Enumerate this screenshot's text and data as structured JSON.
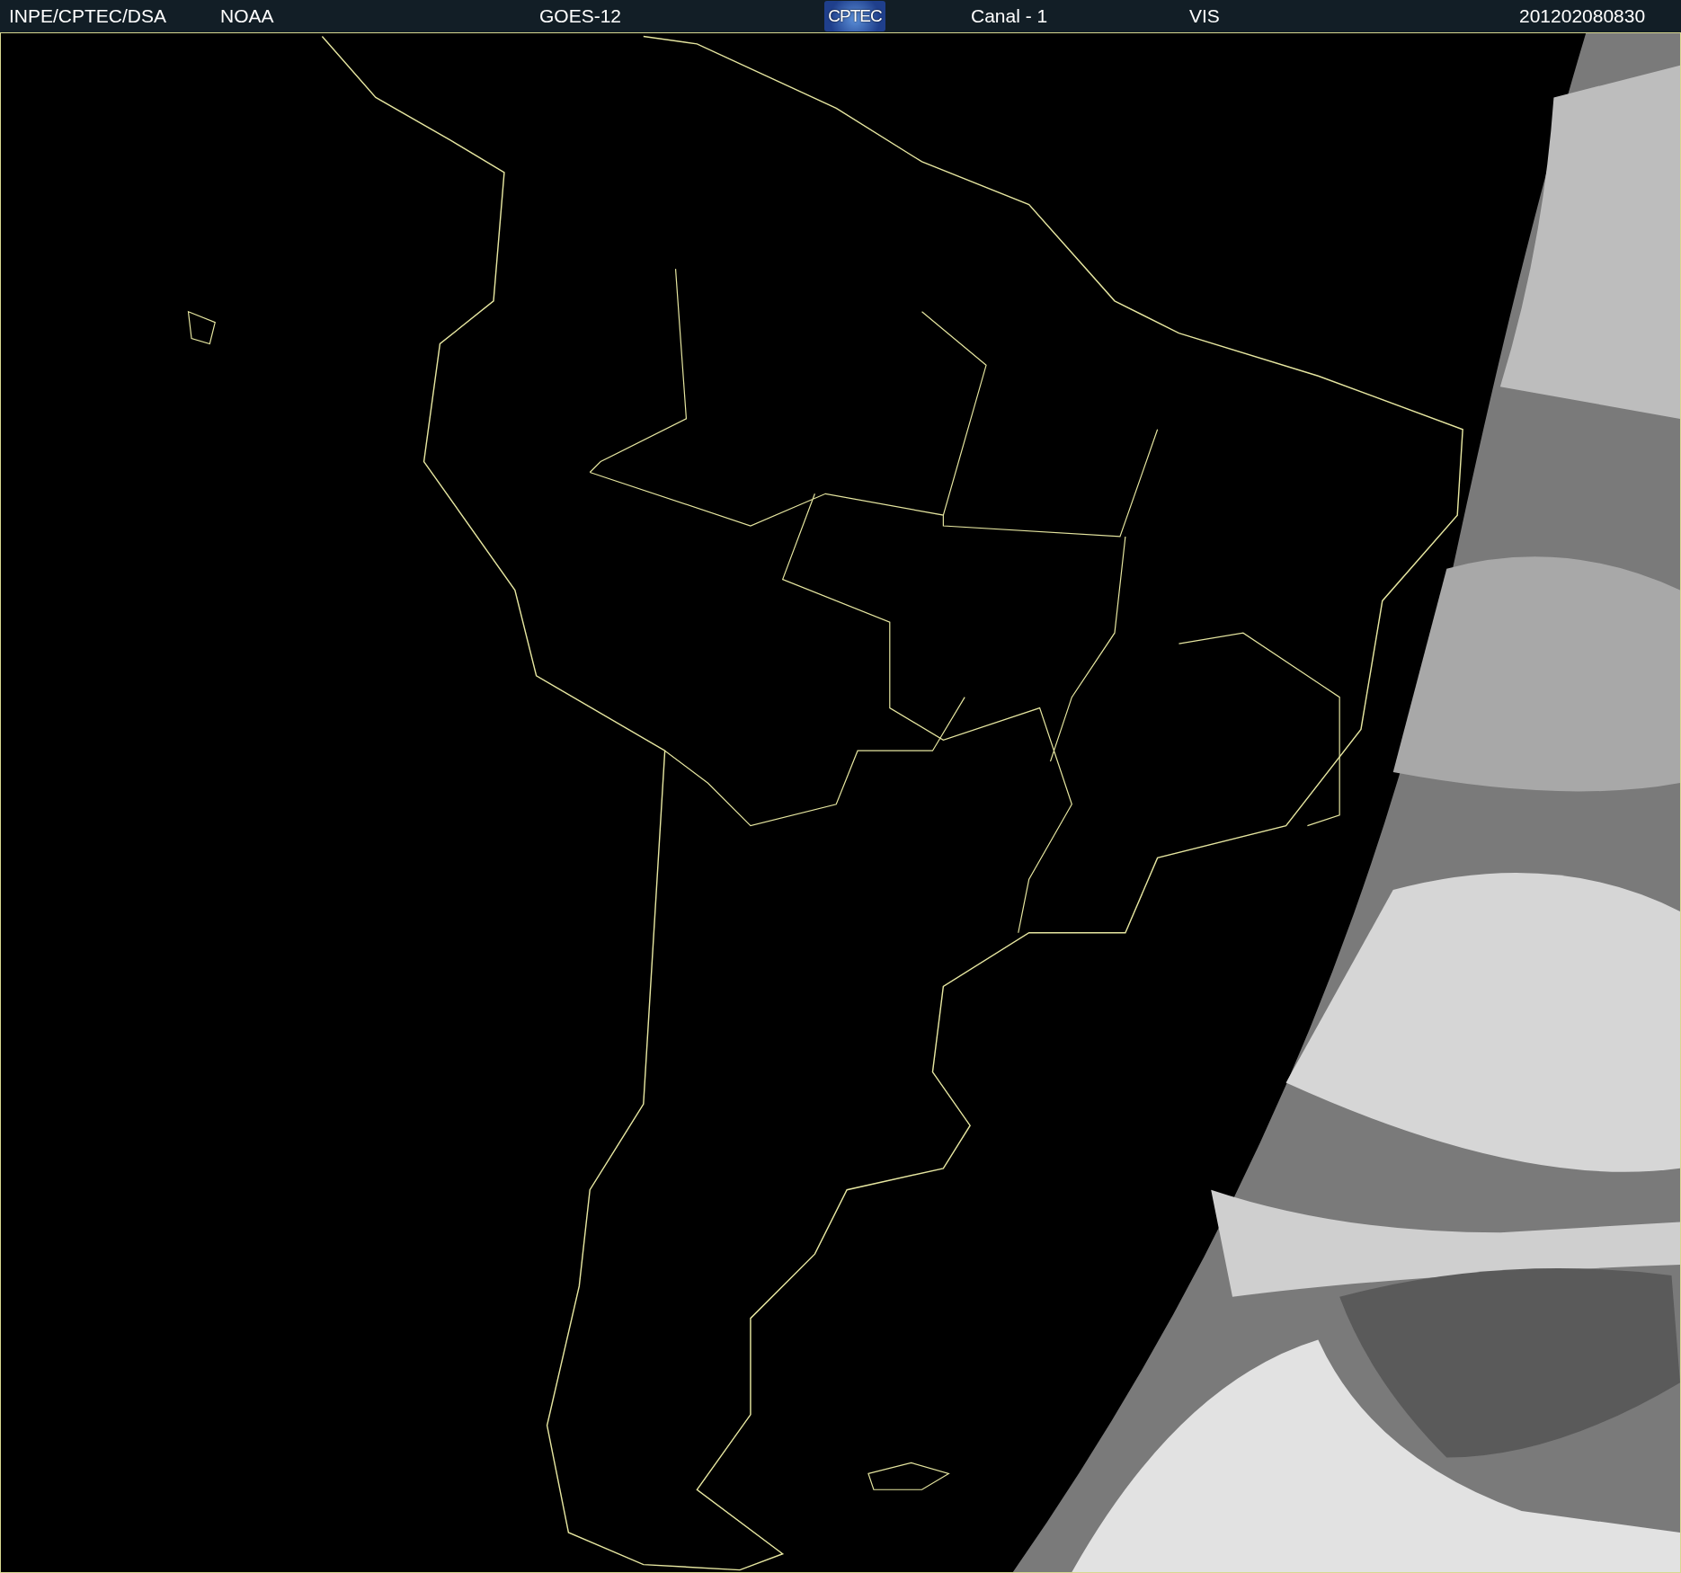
{
  "header": {
    "items": [
      {
        "kind": "text",
        "text": "INPE/CPTEC/DSA"
      },
      {
        "kind": "text",
        "text": "NOAA"
      },
      {
        "kind": "text",
        "text": "GOES-12"
      },
      {
        "kind": "logo",
        "text": "CPTEC"
      },
      {
        "kind": "text",
        "text": "Canal - 1"
      },
      {
        "kind": "text",
        "text": "VIS"
      },
      {
        "kind": "text",
        "text": "201202080830"
      }
    ]
  }
}
